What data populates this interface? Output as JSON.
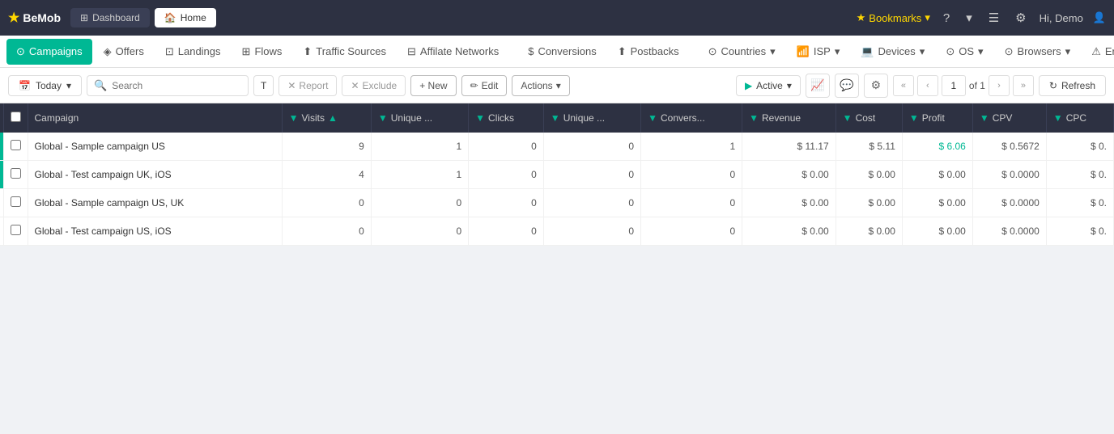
{
  "app": {
    "logo": "BeMob",
    "logo_icon": "★"
  },
  "top_nav": {
    "dashboard_label": "Dashboard",
    "home_label": "Home",
    "bookmarks_label": "Bookmarks",
    "help_icon": "?",
    "user_label": "Hi, Demo"
  },
  "sub_nav": {
    "items": [
      {
        "label": "Campaigns",
        "icon": "⊙",
        "active": true
      },
      {
        "label": "Offers",
        "icon": "◈"
      },
      {
        "label": "Landings",
        "icon": "⊡"
      },
      {
        "label": "Flows",
        "icon": "⊞"
      },
      {
        "label": "Traffic Sources",
        "icon": "⬆"
      },
      {
        "label": "Affilate Networks",
        "icon": "⊟"
      },
      {
        "label": "Conversions",
        "icon": "$"
      },
      {
        "label": "Postbacks",
        "icon": "⬆"
      },
      {
        "label": "Countries",
        "icon": "⊙"
      },
      {
        "label": "ISP",
        "icon": "📶"
      },
      {
        "label": "Devices",
        "icon": "💻"
      },
      {
        "label": "OS",
        "icon": "⊙"
      },
      {
        "label": "Browsers",
        "icon": "⊙"
      },
      {
        "label": "Errors",
        "icon": "⚠"
      }
    ]
  },
  "toolbar": {
    "date_label": "Today",
    "search_placeholder": "Search",
    "filter_label": "T",
    "report_label": "Report",
    "exclude_label": "Exclude",
    "new_label": "+ New",
    "edit_label": "Edit",
    "actions_label": "Actions",
    "active_label": "Active",
    "refresh_label": "Refresh",
    "page_current": "1",
    "page_total": "of 1"
  },
  "table": {
    "columns": [
      {
        "key": "checkbox",
        "label": ""
      },
      {
        "key": "campaign",
        "label": "Campaign"
      },
      {
        "key": "visits",
        "label": "Visits"
      },
      {
        "key": "unique_visits",
        "label": "Unique ..."
      },
      {
        "key": "clicks",
        "label": "Clicks"
      },
      {
        "key": "unique_clicks",
        "label": "Unique ..."
      },
      {
        "key": "conversions",
        "label": "Convers..."
      },
      {
        "key": "revenue",
        "label": "Revenue"
      },
      {
        "key": "cost",
        "label": "Cost"
      },
      {
        "key": "profit",
        "label": "Profit"
      },
      {
        "key": "cpv",
        "label": "CPV"
      },
      {
        "key": "cpc",
        "label": "CPC"
      }
    ],
    "rows": [
      {
        "campaign": "Global - Sample campaign US",
        "visits": "9",
        "unique_visits": "1",
        "clicks": "0",
        "unique_clicks": "0",
        "conversions": "1",
        "revenue": "$ 11.17",
        "cost": "$ 5.11",
        "profit": "$ 6.06",
        "cpv": "$ 0.5672",
        "cpc": "$ 0.",
        "profit_positive": true,
        "indicator": "green"
      },
      {
        "campaign": "Global - Test campaign UK, iOS",
        "visits": "4",
        "unique_visits": "1",
        "clicks": "0",
        "unique_clicks": "0",
        "conversions": "0",
        "revenue": "$ 0.00",
        "cost": "$ 0.00",
        "profit": "$ 0.00",
        "cpv": "$ 0.0000",
        "cpc": "$ 0.",
        "profit_positive": false,
        "indicator": "green"
      },
      {
        "campaign": "Global - Sample campaign US, UK",
        "visits": "0",
        "unique_visits": "0",
        "clicks": "0",
        "unique_clicks": "0",
        "conversions": "0",
        "revenue": "$ 0.00",
        "cost": "$ 0.00",
        "profit": "$ 0.00",
        "cpv": "$ 0.0000",
        "cpc": "$ 0.",
        "profit_positive": false,
        "indicator": "none"
      },
      {
        "campaign": "Global - Test campaign US, iOS",
        "visits": "0",
        "unique_visits": "0",
        "clicks": "0",
        "unique_clicks": "0",
        "conversions": "0",
        "revenue": "$ 0.00",
        "cost": "$ 0.00",
        "profit": "$ 0.00",
        "cpv": "$ 0.0000",
        "cpc": "$ 0.",
        "profit_positive": false,
        "indicator": "none"
      }
    ]
  }
}
